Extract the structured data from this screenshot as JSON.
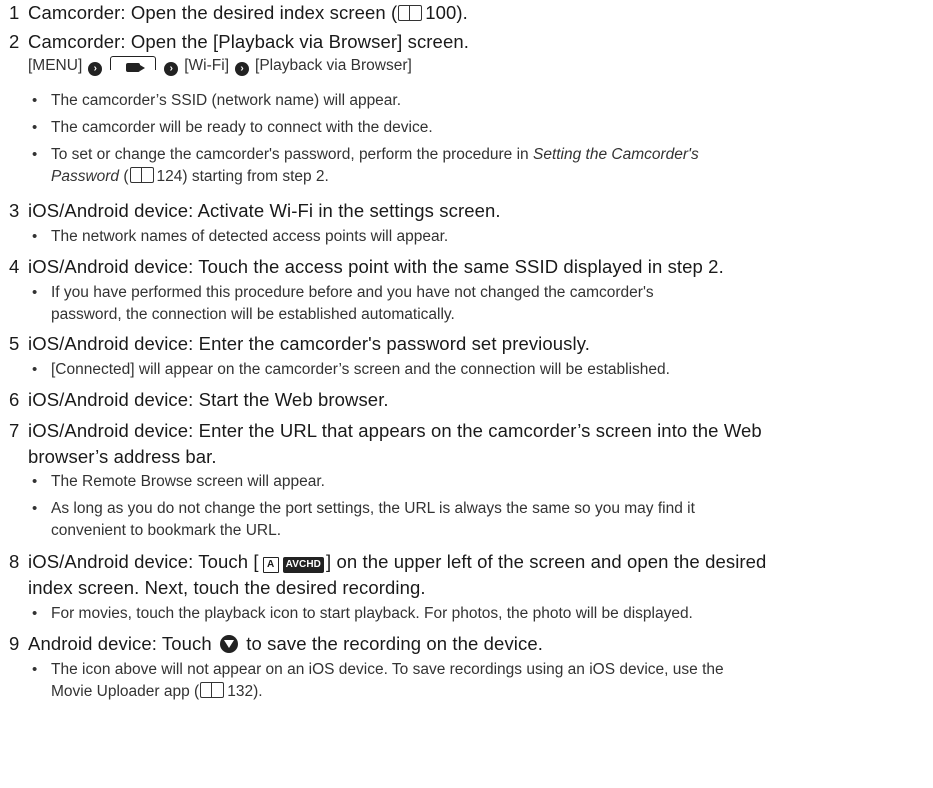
{
  "steps": [
    {
      "num": "1",
      "head": "Camcorder: Open the desired index screen (",
      "ref": "100",
      "tail": ")."
    },
    {
      "num": "2",
      "head": "Camcorder: Open the [Playback via Browser] screen.",
      "menu": {
        "a": "[MENU]",
        "b": "[Wi-Fi]",
        "c": "[Playback via Browser]"
      },
      "bullets": [
        "The camcorder’s SSID (network name) will appear.",
        "The camcorder will be ready to connect with the device."
      ],
      "bullet3": {
        "a": "To set or change the camcorder's password, perform the procedure in ",
        "italic_a": "Setting the Camcorder's",
        "italic_b": "Password",
        "b": " (",
        "ref": "124",
        "c": ") starting from step 2."
      }
    },
    {
      "num": "3",
      "head": "iOS/Android device: Activate Wi-Fi in the settings screen.",
      "bullets": [
        "The network names of detected access points will appear."
      ]
    },
    {
      "num": "4",
      "head": "iOS/Android device: Touch the access point with the same SSID displayed in step 2.",
      "bullet_l1": "If you have performed this procedure before and you have not changed the camcorder's",
      "bullet_l2": "password, the connection will be established automatically."
    },
    {
      "num": "5",
      "head": "iOS/Android device: Enter the camcorder's password set previously.",
      "bullets": [
        "[Connected] will appear on the camcorder’s screen and the connection will be established."
      ]
    },
    {
      "num": "6",
      "head": "iOS/Android device: Start the Web browser."
    },
    {
      "num": "7",
      "head_l1": "iOS/Android device: Enter the URL that appears on the camcorder’s screen into the Web",
      "head_l2": "browser’s address bar.",
      "bullets": [
        "The Remote Browse screen will appear."
      ],
      "bullet_l1": "As long as you do not change the port settings, the URL is always the same so you may find it",
      "bullet_l2": "convenient to bookmark the URL."
    },
    {
      "num": "8",
      "head_a": "iOS/Android device: Touch [",
      "icon_a": "A",
      "icon_b": "AVCHD",
      "head_b": "] on the upper left of the screen and open the desired",
      "head_l2": "index screen. Next, touch the desired recording.",
      "bullets": [
        "For movies, touch the playback icon to start playback. For photos, the photo will be displayed."
      ]
    },
    {
      "num": "9",
      "head_a": "Android device: Touch ",
      "head_b": " to save the recording on the device.",
      "bullet_l1": "The icon above will not appear on an iOS device. To save recordings using an iOS device, use the",
      "bullet_l2a": "Movie Uploader app (",
      "ref": "132",
      "bullet_l2b": ")."
    }
  ],
  "icons": [
    "book-icon",
    "chevron-right-icon",
    "playback-tab-icon",
    "download-icon",
    "mode-a-icon",
    "avchd-icon"
  ]
}
